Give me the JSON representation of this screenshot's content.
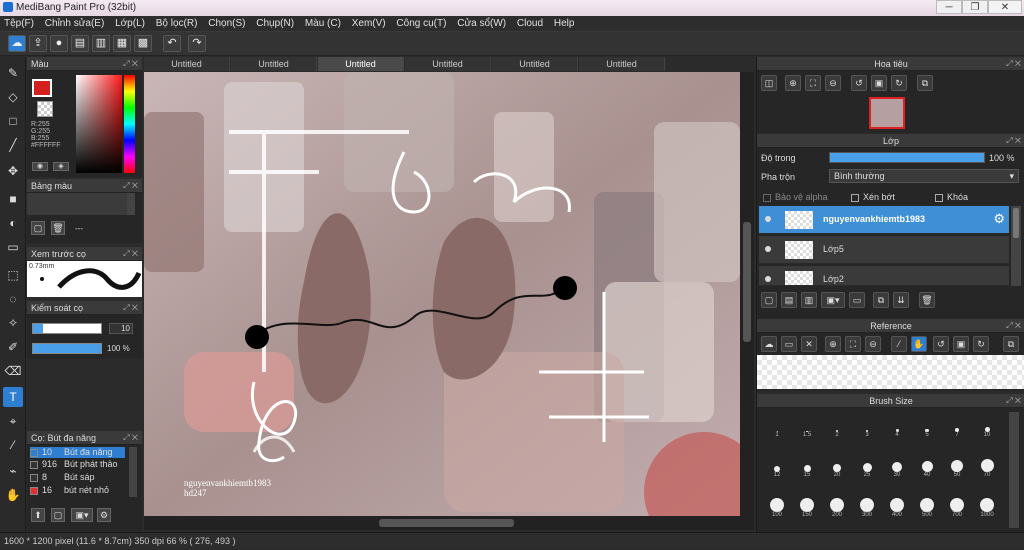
{
  "app": {
    "title": "MediBang Paint Pro (32bit)"
  },
  "menu": [
    "Tệp(F)",
    "Chỉnh sửa(E)",
    "Lớp(L)",
    "Bộ lọc(R)",
    "Chọn(S)",
    "Chụp(N)",
    "Màu (C)",
    "Xem(V)",
    "Công cụ(T)",
    "Cửa sổ(W)",
    "Cloud",
    "Help"
  ],
  "doc_tabs": [
    "Untitled",
    "Untitled",
    "Untitled",
    "Untitled",
    "Untitled",
    "Untitled"
  ],
  "color_panel": {
    "title": "Màu",
    "readout": [
      "R:255",
      "G:255",
      "B:255",
      "#FFFFFF"
    ]
  },
  "palette_panel": {
    "title": "Bảng màu",
    "value": "---"
  },
  "preview_panel": {
    "title": "Xem trước cọ",
    "size": "0.73mm"
  },
  "control_panel": {
    "title": "Kiểm soát cọ",
    "size_value": "10",
    "opacity_value": "100 %",
    "opacity_fraction": 1.0
  },
  "brush_panel": {
    "title": "Cọ: Bút đa năng",
    "brushes": [
      {
        "size": "10",
        "name": "Bút đa năng",
        "color": "#2e7fd1"
      },
      {
        "size": "916",
        "name": "Bút phát thảo",
        "color": "#333333"
      },
      {
        "size": "8",
        "name": "Bút sáp",
        "color": "#333333"
      },
      {
        "size": "16",
        "name": "bút nét nhỏ",
        "color": "#e03030"
      }
    ]
  },
  "canvas": {
    "watermark_line1": "nguyenvankhiemtb1983",
    "watermark_line2": "hd247"
  },
  "navigator": {
    "title": "Hoa tiêu"
  },
  "layers": {
    "title": "Lớp",
    "opacity_label": "Độ trong",
    "opacity_value": "100 %",
    "opacity_fraction": 1.0,
    "blend_label": "Pha trộn",
    "blend_value": "Bình thường",
    "protect_alpha": "Bảo vệ alpha",
    "clipping": "Xén bớt",
    "lock": "Khóa",
    "items": [
      "nguyenvankhiemtb1983",
      "Lớp5",
      "Lớp2"
    ]
  },
  "reference": {
    "title": "Reference"
  },
  "brush_size": {
    "title": "Brush Size",
    "sizes": [
      "1",
      "1.5",
      "2",
      "3",
      "4",
      "5",
      "7",
      "10",
      "12",
      "15",
      "20",
      "25",
      "30",
      "40",
      "50",
      "70",
      "100",
      "150",
      "200",
      "300",
      "400",
      "500",
      "700",
      "1000"
    ]
  },
  "status": {
    "text": "1600 * 1200 pixel  (11.6 * 8.7cm)  350 dpi  66 %  ( 276, 493 )"
  }
}
